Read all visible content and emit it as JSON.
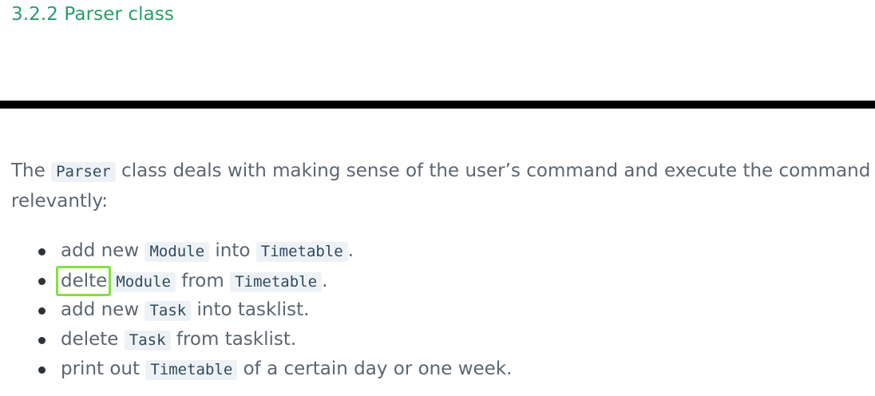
{
  "section": {
    "heading": "3.2.2 Parser class"
  },
  "intro": {
    "before": "The ",
    "code": "Parser",
    "after": " class deals with making sense of the user’s command and execute the command relevantly:"
  },
  "items": [
    {
      "t1": "add new ",
      "c1": "Module",
      "t2": " into ",
      "c2": "Timetable",
      "t3": "."
    },
    {
      "t1": "delte",
      "c1": "Module",
      "t2": " from ",
      "c2": "Timetable",
      "t3": "."
    },
    {
      "t1": "add new ",
      "c1": "Task",
      "t2": " into tasklist."
    },
    {
      "t1": "delete ",
      "c1": "Task",
      "t2": " from tasklist."
    },
    {
      "t1": "print out ",
      "c1": "Timetable",
      "t2": " of a certain day or one week."
    }
  ],
  "colors": {
    "heading": "#22a06b",
    "highlight_border": "#82e23a",
    "rule": "#000000"
  }
}
